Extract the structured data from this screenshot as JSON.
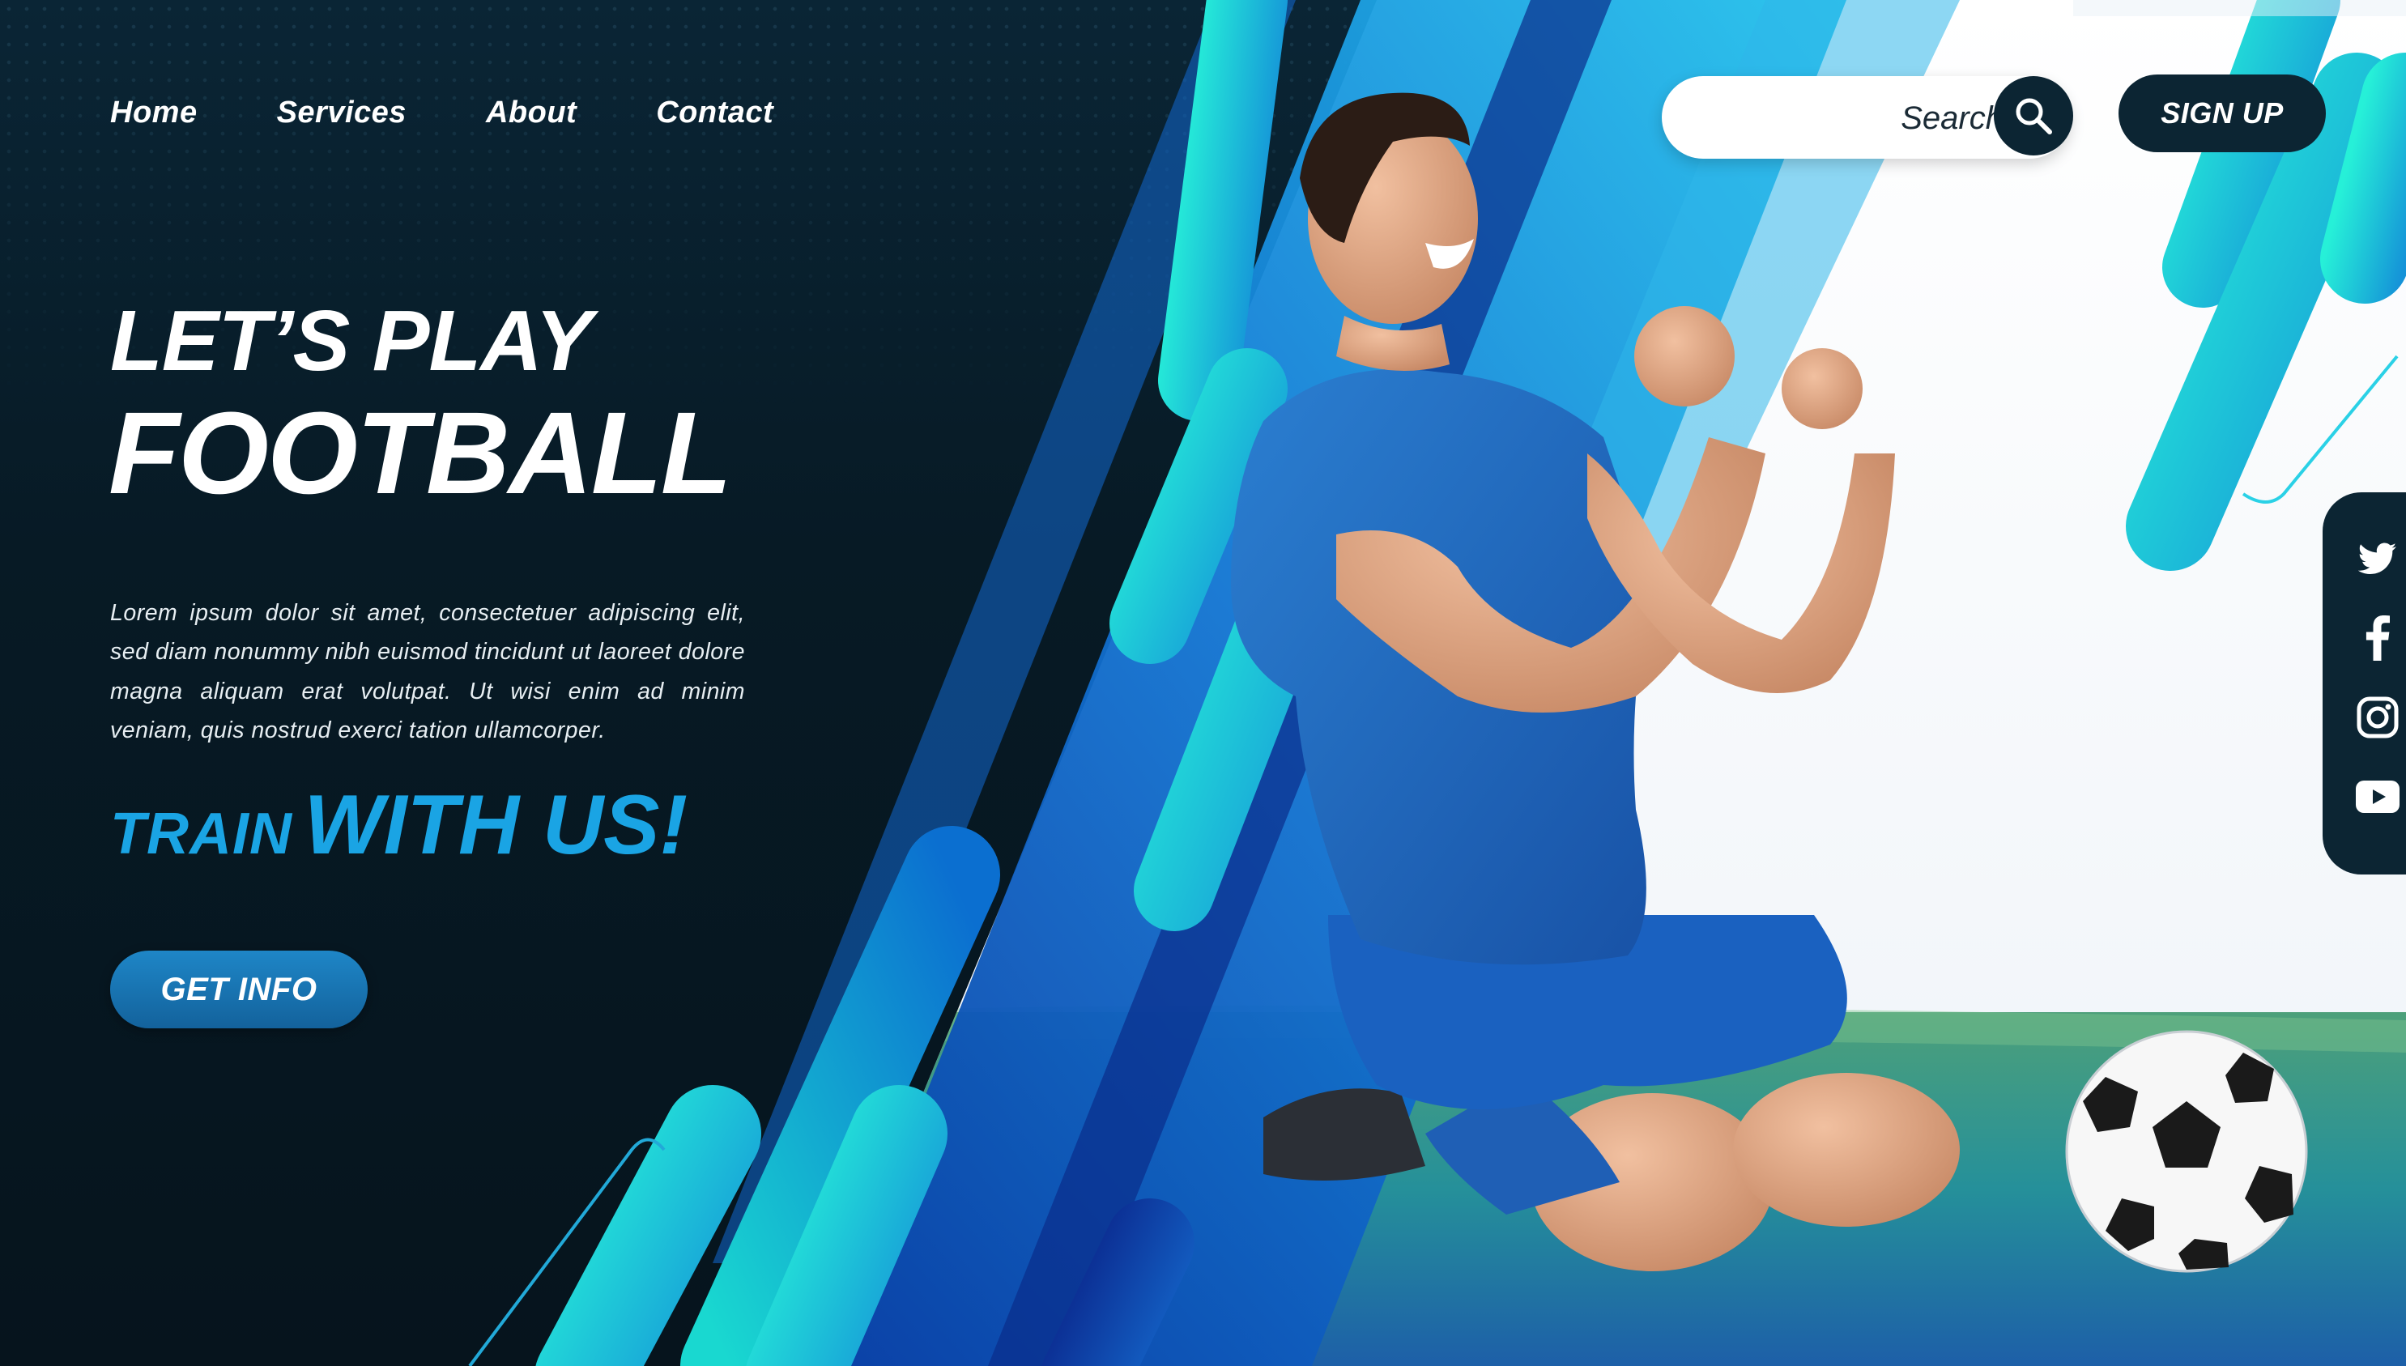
{
  "nav": {
    "items": [
      {
        "label": "Home"
      },
      {
        "label": "Services"
      },
      {
        "label": "About"
      },
      {
        "label": "Contact"
      }
    ]
  },
  "search": {
    "placeholder": "Search"
  },
  "header": {
    "signup_label": "SIGN UP"
  },
  "hero": {
    "title_line1": "LET’S PLAY",
    "title_line2": "FOOTBALL",
    "body": "Lorem ipsum dolor sit amet, consectetuer adipiscing elit, sed diam nonummy nibh euismod tincidunt ut laoreet dolore magna aliquam erat volutpat. Ut wisi enim ad minim veniam, quis nostrud exerci tation ullamcorper.",
    "tagline_small": "TRAIN",
    "tagline_big": "WITH US!",
    "cta_label": "GET INFO"
  },
  "social": {
    "icons": [
      "twitter-icon",
      "facebook-icon",
      "instagram-icon",
      "youtube-icon"
    ]
  },
  "colors": {
    "background": "#071a25",
    "accent": "#1aa4e4",
    "teal": "#22e0d6",
    "navy": "#0c2533"
  }
}
